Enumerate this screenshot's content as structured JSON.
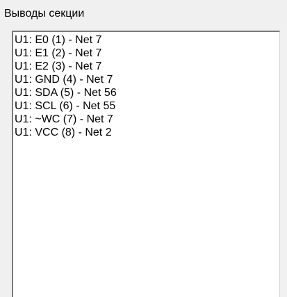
{
  "section_pins": {
    "label": "Выводы секции",
    "items": [
      "U1: E0 (1) - Net 7",
      "U1: E1 (2) - Net 7",
      "U1: E2 (3) - Net 7",
      "U1: GND (4) - Net 7",
      "U1: SDA (5) - Net 56",
      "U1: SCL (6) - Net 55",
      "U1: ~WC (7) - Net 7",
      "U1: VCC (8) - Net 2"
    ]
  }
}
